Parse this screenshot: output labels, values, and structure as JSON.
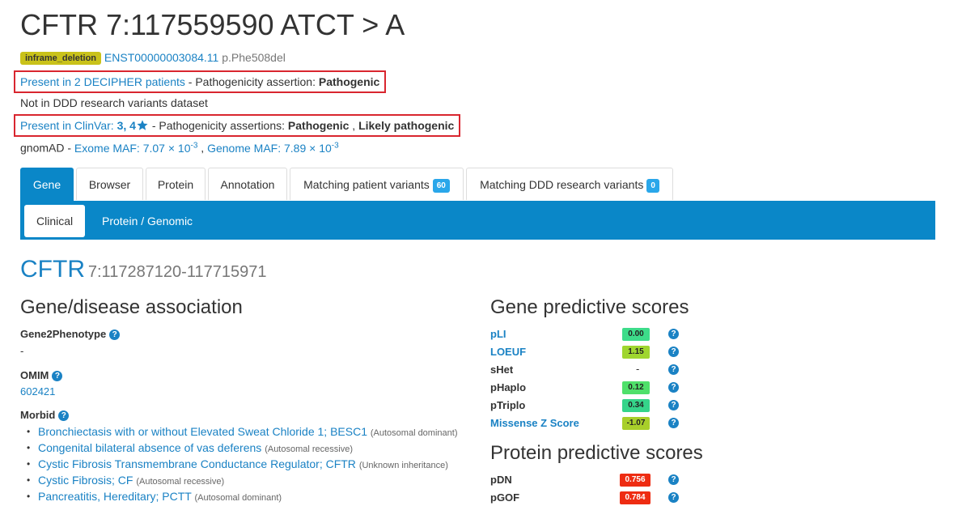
{
  "variant": {
    "title": "CFTR 7:117559590 ATCT > A",
    "consequence_badge": "inframe_deletion",
    "transcript": "ENST00000003084.11",
    "protein_change": "p.Phe508del",
    "decipher_link": "Present in 2 DECIPHER patients",
    "decipher_assertion_prefix": " - Pathogenicity assertion: ",
    "decipher_assertion": "Pathogenic",
    "ddd_text": "Not in DDD research variants dataset",
    "clinvar_link": "Present in ClinVar: ",
    "clinvar_stars": "3, 4",
    "star_icon": "star-icon",
    "clinvar_assertion_prefix": " - Pathogenicity assertions: ",
    "clinvar_assertion_1": "Pathogenic",
    "clinvar_sep": " , ",
    "clinvar_assertion_2": "Likely pathogenic",
    "gnomad_label": "gnomAD - ",
    "exome_maf": "Exome MAF: 7.07 × 10",
    "exome_exp": "-3",
    "gnomad_sep": " , ",
    "genome_maf": "Genome MAF: 7.89 × 10",
    "genome_exp": "-3"
  },
  "tabs": {
    "gene": "Gene",
    "browser": "Browser",
    "protein": "Protein",
    "annotation": "Annotation",
    "matching_patient": "Matching patient variants",
    "matching_patient_count": "60",
    "matching_ddd": "Matching DDD research variants",
    "matching_ddd_count": "0"
  },
  "subtabs": {
    "clinical": "Clinical",
    "protein_genomic": "Protein / Genomic"
  },
  "gene": {
    "name": "CFTR",
    "location": "7:117287120-117715971"
  },
  "association": {
    "heading": "Gene/disease association",
    "g2p_label": "Gene2Phenotype",
    "g2p_value": "-",
    "omim_label": "OMIM",
    "omim_value": "602421",
    "morbid_label": "Morbid",
    "morbid_items": [
      {
        "name": "Bronchiectasis with or without Elevated Sweat Chloride 1; BESC1",
        "inheritance": "(Autosomal dominant)"
      },
      {
        "name": "Congenital bilateral absence of vas deferens",
        "inheritance": "(Autosomal recessive)"
      },
      {
        "name": "Cystic Fibrosis Transmembrane Conductance Regulator; CFTR",
        "inheritance": "(Unknown inheritance)"
      },
      {
        "name": "Cystic Fibrosis; CF",
        "inheritance": "(Autosomal recessive)"
      },
      {
        "name": "Pancreatitis, Hereditary; PCTT",
        "inheritance": "(Autosomal dominant)"
      }
    ]
  },
  "gene_scores": {
    "heading": "Gene predictive scores",
    "rows": [
      {
        "label": "pLI",
        "value": "0.00",
        "color": "#3ddc8a",
        "link": true
      },
      {
        "label": "LOEUF",
        "value": "1.15",
        "color": "#9fd62f",
        "link": true
      },
      {
        "label": "sHet",
        "value": "-",
        "color": "",
        "link": false
      },
      {
        "label": "pHaplo",
        "value": "0.12",
        "color": "#4fe06a",
        "link": false
      },
      {
        "label": "pTriplo",
        "value": "0.34",
        "color": "#35d48a",
        "link": false
      },
      {
        "label": "Missense Z Score",
        "value": "-1.07",
        "color": "#a8cf2a",
        "link": true
      }
    ]
  },
  "protein_scores": {
    "heading": "Protein predictive scores",
    "rows": [
      {
        "label": "pDN",
        "value": "0.756",
        "color": "#ee2c12",
        "text_color": "#ffffff"
      },
      {
        "label": "pGOF",
        "value": "0.784",
        "color": "#ee2c12",
        "text_color": "#ffffff"
      }
    ]
  },
  "help_icon": "question-icon"
}
